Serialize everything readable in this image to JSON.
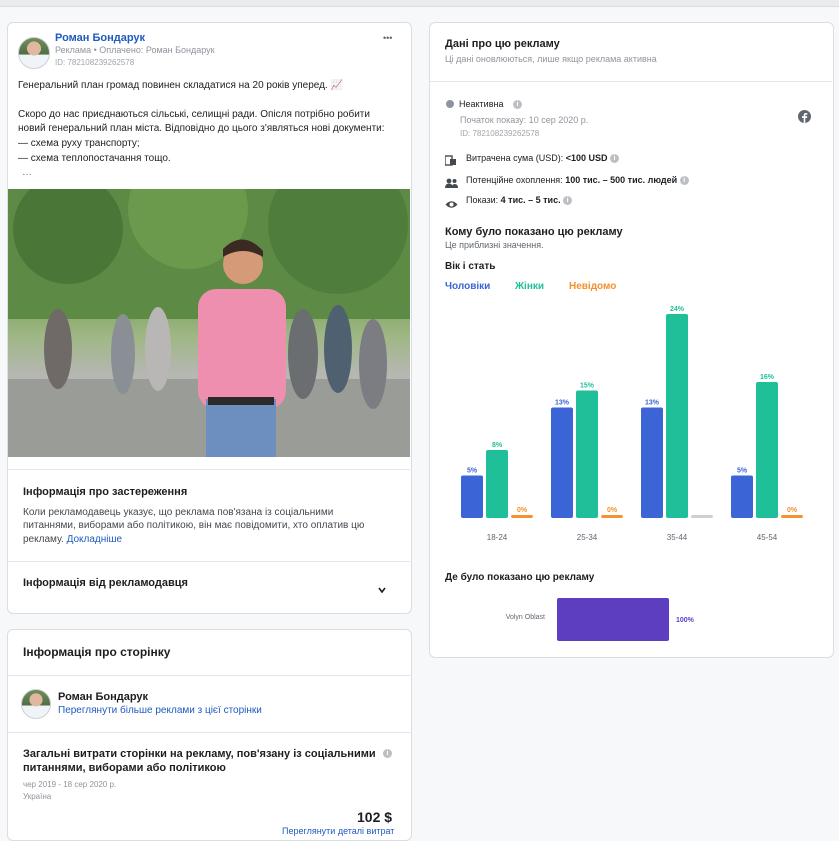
{
  "post": {
    "page_name": "Роман Бондарук",
    "sponsor_line": "Реклама • Оплачено: Роман Бондарук",
    "id_line": "ID: 782108239262578",
    "body_lines": [
      "Генеральний план громад повинен складатися на 20 років уперед. 📈",
      "",
      "Скоро до нас приєднаються сільські, селищні ради. Опісля потрібно робити",
      "новий генеральний план міста. Відповідно до цього з'являться нові документи:",
      "— схема руху транспорту;",
      "— схема теплопостачання тощо."
    ],
    "ellipsis": "…",
    "menu_label": "•••"
  },
  "disclaimer": {
    "title": "Інформація про застереження",
    "text_lines": [
      "Коли рекламодавець указує, що реклама пов'язана із соціальними",
      "питаннями, виборами або політикою, він має повідомити, хто оплатив цю",
      "рекламу."
    ],
    "more_link": "Докладніше"
  },
  "advertiser_info": {
    "title": "Інформація від рекламодавця"
  },
  "page_info": {
    "title": "Інформація про сторінку",
    "page_name": "Роман Бондарук",
    "more_ads_link": "Переглянути більше реклами з цієї сторінки",
    "spend_title_lines": [
      "Загальні витрати сторінки на рекламу, пов'язану із соціальними",
      "питаннями, виборами або політикою"
    ],
    "period": "чер 2019 - 18 сер 2020 р.",
    "country": "Україна",
    "amount": "102 $",
    "details_link": "Переглянути деталі витрат"
  },
  "ad_data": {
    "title": "Дані про цю рекламу",
    "subtitle": "Ці дані оновлюються, лише якщо реклама активна",
    "status": "Неактивна",
    "start": "Початок показу: 10 сер 2020 р.",
    "id_line": "ID: 782108239262578",
    "spend_label": "Витрачена сума (USD): ",
    "spend_value": "<100 USD",
    "reach_label": "Потенційне охоплення: ",
    "reach_value": "100 тис. – 500 тис. людей",
    "impressions_label": "Покази: ",
    "impressions_value": "4 тис. – 5 тис.",
    "audience_title": "Кому було показано цю рекламу",
    "audience_note": "Це приблизні значення.",
    "age_gender_title": "Вік і стать",
    "legend": {
      "male": "Чоловіки",
      "female": "Жінки",
      "unknown": "Невідомо"
    },
    "region_title": "Де було показано цю рекламу"
  },
  "colors": {
    "male": "#3b64d6",
    "female": "#1fbf9a",
    "unknown": "#f5902c",
    "region": "#5d3ec0",
    "link": "#1d5bbf"
  },
  "chart_data": [
    {
      "type": "bar",
      "title": "Вік і стать",
      "categories": [
        "18-24",
        "25-34",
        "35-44",
        "45-54"
      ],
      "series": [
        {
          "name": "Чоловіки",
          "values": [
            5,
            13,
            13,
            5
          ],
          "labels": [
            "5%",
            "13%",
            "13%",
            "5%"
          ]
        },
        {
          "name": "Жінки",
          "values": [
            8,
            15,
            24,
            16
          ],
          "labels": [
            "8%",
            "15%",
            "24%",
            "16%"
          ]
        },
        {
          "name": "Невідомо",
          "values": [
            0,
            0,
            0,
            0
          ],
          "labels": [
            "0%",
            "0%",
            "",
            "0%"
          ]
        }
      ],
      "ylim": [
        0,
        24
      ],
      "grid": false,
      "legend": "top-left"
    },
    {
      "type": "bar",
      "title": "Де було показано цю рекламу",
      "categories": [
        "Volyn Oblast"
      ],
      "values": [
        100
      ],
      "labels": [
        "100%"
      ],
      "orientation": "horizontal",
      "xlim": [
        0,
        100
      ]
    }
  ]
}
